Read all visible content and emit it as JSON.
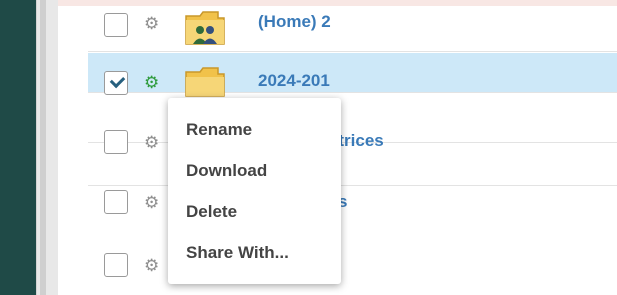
{
  "files": [
    {
      "name": "(Home) 2",
      "checked": false
    },
    {
      "name": "2024-201",
      "checked": true
    },
    {
      "name": "ntrices",
      "checked": false
    },
    {
      "name": "s",
      "checked": false
    },
    {
      "name": "",
      "checked": false
    }
  ],
  "context_menu": {
    "items": [
      "Rename",
      "Download",
      "Delete",
      "Share With..."
    ]
  },
  "icons": {
    "gear": "gear-icon",
    "folder": "folder-icon",
    "group": "group-icon",
    "checkbox": "checkbox"
  },
  "colors": {
    "selected_row": "#cde8f8",
    "link": "#3a7ab8",
    "gear_active": "#2e9b3c",
    "sidebar": "#1f4a47"
  }
}
